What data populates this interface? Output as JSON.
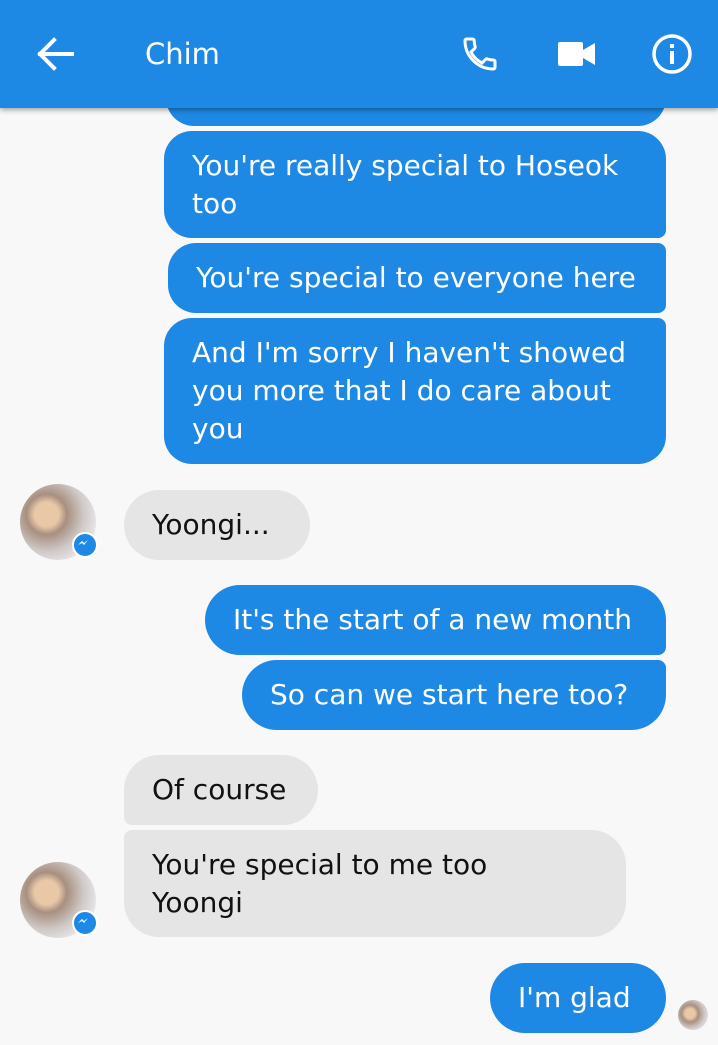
{
  "header": {
    "title": "Chim",
    "colors": {
      "bar": "#1e88e5",
      "icons": "#ffffff"
    },
    "icons": [
      "back-arrow-icon",
      "phone-icon",
      "video-camera-icon",
      "info-icon"
    ]
  },
  "messages": [
    {
      "sender": "me",
      "text": "You're really special to Hoseok\ntoo"
    },
    {
      "sender": "me",
      "text": "You're special to everyone here"
    },
    {
      "sender": "me",
      "text": "And I'm sorry I haven't showed\nyou more that I do care about\nyou"
    },
    {
      "sender": "Chim",
      "text": "Yoongi..."
    },
    {
      "sender": "me",
      "text": "It's the start of a new month"
    },
    {
      "sender": "me",
      "text": "So can we start here too?"
    },
    {
      "sender": "Chim",
      "text": "Of course"
    },
    {
      "sender": "Chim",
      "text": "You're special to me too\nYoongi"
    },
    {
      "sender": "me",
      "text": "I'm glad"
    }
  ],
  "colors": {
    "outgoing": "#1e88e5",
    "incoming": "#e5e5e5",
    "background": "#f8f8f8"
  }
}
